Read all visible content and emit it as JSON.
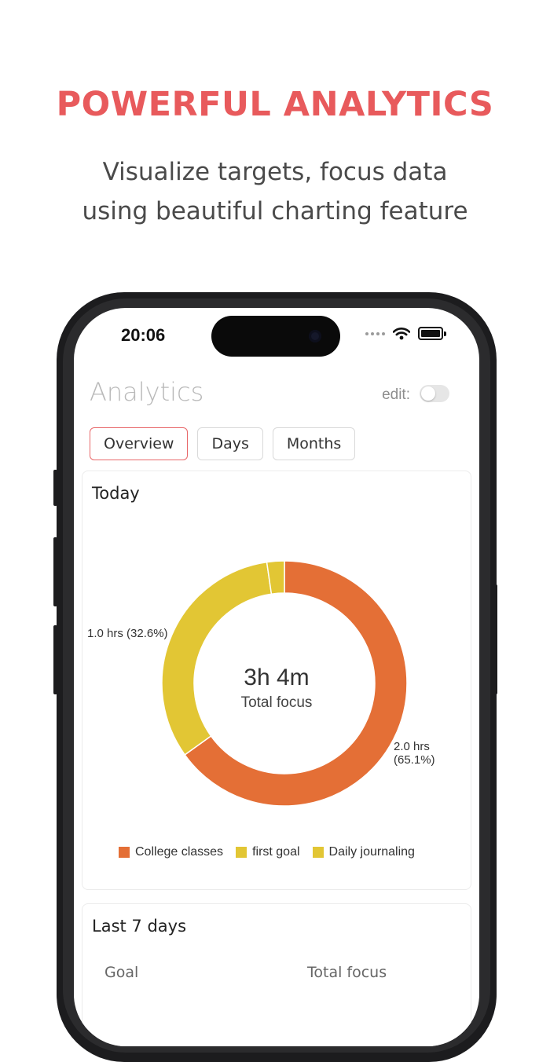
{
  "marketing": {
    "headline": "POWERFUL ANALYTICS",
    "subline_1": "Visualize targets, focus data",
    "subline_2": "using beautiful charting feature"
  },
  "status_bar": {
    "time": "20:06"
  },
  "header": {
    "title": "Analytics",
    "edit_label": "edit:",
    "edit_enabled": false
  },
  "tabs": [
    {
      "label": "Overview",
      "selected": true
    },
    {
      "label": "Days",
      "selected": false
    },
    {
      "label": "Months",
      "selected": false
    }
  ],
  "today_card": {
    "title": "Today",
    "total_value": "3h 4m",
    "total_label": "Total focus",
    "slice_labels": {
      "college": "2.0 hrs (65.1%)",
      "first_goal": "1.0 hrs (32.6%)"
    }
  },
  "chart_data": {
    "type": "pie",
    "title": "Today",
    "series": [
      {
        "name": "College classes",
        "value": 65.1,
        "hours": 2.0,
        "color": "#e46f36"
      },
      {
        "name": "first goal",
        "value": 32.6,
        "hours": 1.0,
        "color": "#e2c634"
      },
      {
        "name": "Daily journaling",
        "value": 2.3,
        "color": "#e2c634"
      }
    ],
    "center_text": "3h 4m",
    "center_subtext": "Total focus",
    "legend": "bottom"
  },
  "week_card": {
    "title": "Last 7 days",
    "col_goal": "Goal",
    "col_total": "Total focus"
  }
}
